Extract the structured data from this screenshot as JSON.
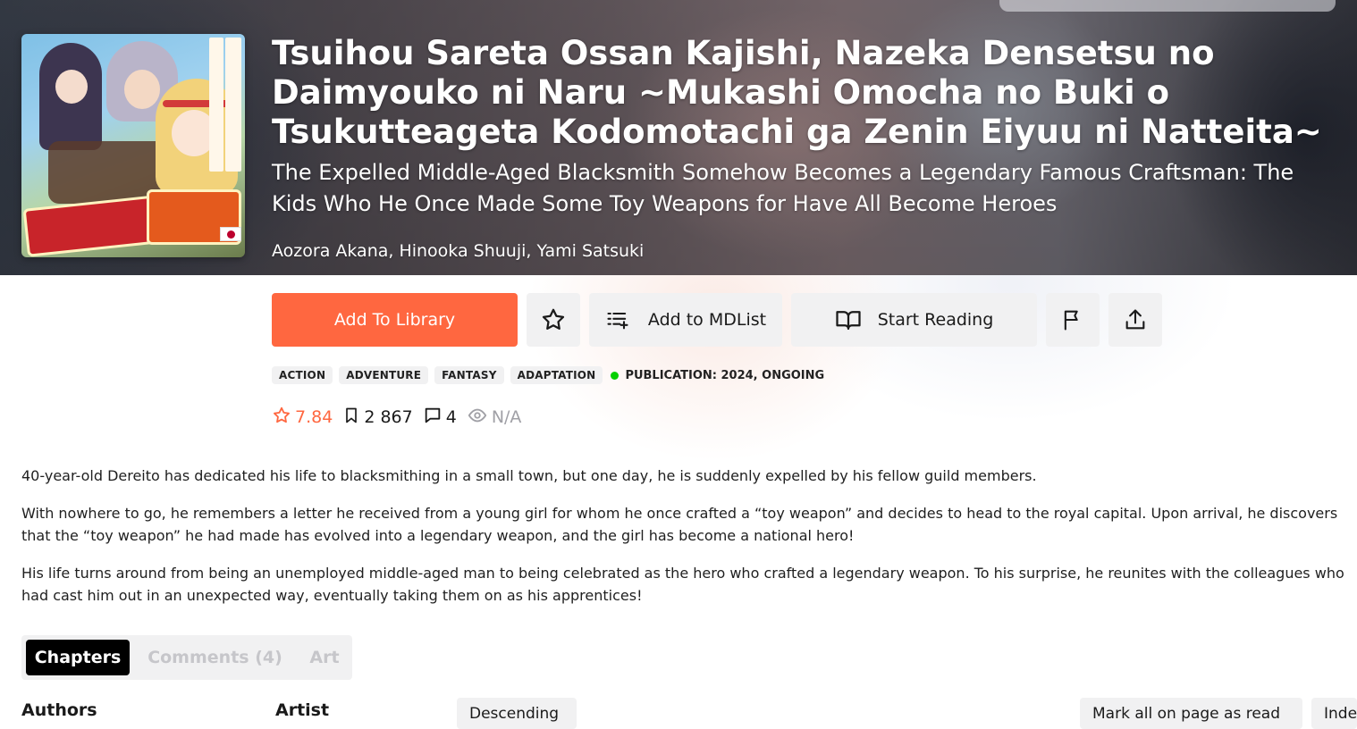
{
  "manga": {
    "title": "Tsuihou Sareta Ossan Kajishi, Nazeka Densetsu no Daimyouko ni Naru ~Mukashi Omocha no Buki o Tsukutteageta Kodomotachi ga Zenin Eiyuu ni Natteita~",
    "alt_title": "The Expelled Middle-Aged Blacksmith Somehow Becomes a Legendary Famous Craftsman: The Kids Who He Once Made Some Toy Weapons for Have All Become Heroes",
    "authors": "Aozora Akana, Hinooka Shuuji, Yami Satsuki",
    "cover_flag": "japan-flag"
  },
  "actions": {
    "add_to_library": "Add To Library",
    "add_to_mdlist": "Add to MDList",
    "start_reading": "Start Reading"
  },
  "tags": [
    "ACTION",
    "ADVENTURE",
    "FANTASY",
    "ADAPTATION"
  ],
  "publication": "PUBLICATION: 2024, ONGOING",
  "stats": {
    "rating": "7.84",
    "follows": "2 867",
    "comments": "4",
    "views": "N/A"
  },
  "description": [
    "40-year-old Dereito has dedicated his life to blacksmithing in a small town, but one day, he is suddenly expelled by his fellow guild members.",
    "With nowhere to go, he remembers a letter he received from a young girl for whom he once crafted a “toy weapon” and decides to head to the royal capital. Upon arrival, he discovers that the “toy weapon” he had made has evolved into a legendary weapon, and the girl has become a national hero!",
    "His life turns around from being an unemployed middle-aged man to being celebrated as the hero who crafted a legendary weapon. To his surprise, he reunites with the colleagues who had cast him out in an unexpected way, eventually taking them on as his apprentices!"
  ],
  "tabs": [
    "Chapters",
    "Comments (4)",
    "Art"
  ],
  "info": {
    "authors_label": "Authors",
    "artist_label": "Artist"
  },
  "chapter_controls": {
    "sort": "Descending",
    "mark_read": "Mark all on page as read",
    "index": "Index"
  },
  "colors": {
    "accent": "#ff6740",
    "status_dot": "#04d000",
    "button_bg": "#f1f1f2"
  }
}
